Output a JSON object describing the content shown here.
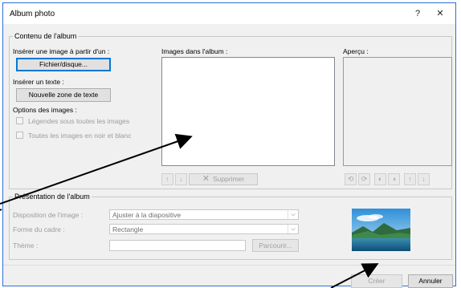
{
  "window": {
    "title": "Album photo",
    "help_label": "?",
    "close_label": "✕"
  },
  "content_group": {
    "legend": "Contenu de l'album",
    "insert_image_label": "Insérer une image à partir d'un :",
    "file_button": "Fichier/disque...",
    "insert_text_label": "Insérer un texte :",
    "textbox_button": "Nouvelle zone de texte",
    "image_options_label": "Options des images :",
    "captions_checkbox": "Légendes sous toutes les images",
    "bw_checkbox": "Toutes les images en noir et blanc",
    "images_list_label": "Images dans l'album :",
    "preview_label": "Aperçu :",
    "remove_button": "Supprimer"
  },
  "layout_group": {
    "legend": "Présentation de l'album",
    "picture_layout_label": "Disposition de l'image :",
    "picture_layout_value": "Ajuster à la diapositive",
    "frame_shape_label": "Forme du cadre :",
    "frame_shape_value": "Rectangle",
    "theme_label": "Thème :",
    "theme_value": "",
    "browse_button": "Parcourir..."
  },
  "footer": {
    "create_button": "Créer",
    "cancel_button": "Annuler"
  },
  "icons": {
    "move_up": "arrow-up-icon",
    "move_down": "arrow-down-icon",
    "remove": "x-icon",
    "rotate_left": "rotate-left-icon",
    "rotate_right": "rotate-right-icon",
    "contrast_more": "contrast-up-icon",
    "contrast_less": "contrast-down-icon",
    "brightness_more": "brightness-up-icon",
    "brightness_less": "brightness-down-icon"
  },
  "colors": {
    "accent": "#0078d7",
    "dialog_bg": "#f0f0f0",
    "annotation_arrow": "#000000"
  }
}
